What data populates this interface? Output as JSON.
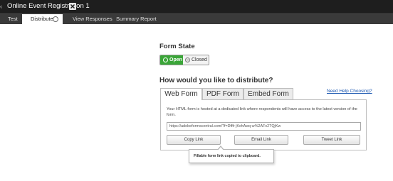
{
  "window": {
    "title": "Online Event Registration 1"
  },
  "tabs": {
    "test": "Test",
    "distribute": "Distribute",
    "view_responses": "View Responses",
    "summary_report": "Summary Report"
  },
  "form_state": {
    "heading": "Form State",
    "open_label": "Open",
    "closed_label": "Closed",
    "selected": "Open",
    "colors": {
      "open": "#3aa638"
    }
  },
  "distribution": {
    "heading": "How would you like to distribute?",
    "tabs": [
      "Web Form",
      "PDF Form",
      "Embed Form"
    ],
    "active_tab": "Web Form",
    "help_link": "Need Help Choosing?",
    "description": "Your HTML form is hosted at a dedicated link where respondents will have access to the latest version of the form.",
    "url": "https://adobeformscentral.com/?f=Dfffr jKxhAwq-w%2AFx2TQjKw",
    "buttons": {
      "copy": "Copy Link",
      "email": "Email Link",
      "tweet": "Tweet Link"
    },
    "tooltip": "Fillable form link copied to clipboard."
  }
}
